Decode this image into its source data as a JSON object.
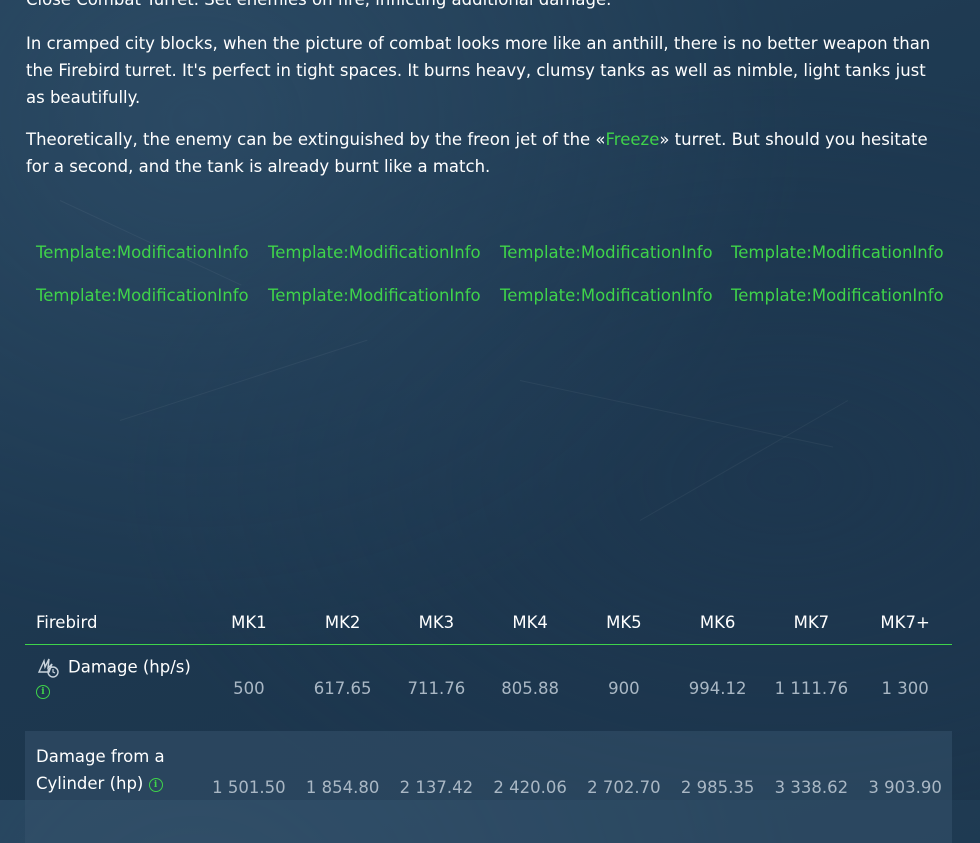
{
  "intro_line": "Close Combat Turret. Set enemies on fire, inflicting additional damage.",
  "paragraph1": "In cramped city blocks, when the picture of combat looks more like an anthill, there is no better weapon than the Firebird turret. It's perfect in tight spaces. It burns heavy, clumsy tanks as well as nimble, light tanks just as beautifully.",
  "paragraph2": {
    "before": "Theoretically, the enemy can be extinguished by the freon jet of the «",
    "link": "Freeze",
    "after": "» turret. But should you hesitate for a second, and the tank is already burnt like a match."
  },
  "modification_links": [
    "Template:ModificationInfo",
    "Template:ModificationInfo",
    "Template:ModificationInfo",
    "Template:ModificationInfo",
    "Template:ModificationInfo",
    "Template:ModificationInfo",
    "Template:ModificationInfo",
    "Template:ModificationInfo"
  ],
  "table": {
    "header": [
      "Firebird",
      "MK1",
      "MK2",
      "MK3",
      "MK4",
      "MK5",
      "MK6",
      "MK7",
      "MK7+"
    ],
    "rows": [
      {
        "label": "Damage (hp/s)",
        "icon": "flame-damage-icon",
        "values": [
          "500",
          "617.65",
          "711.76",
          "805.88",
          "900",
          "994.12",
          "1 111.76",
          "1 300"
        ]
      },
      {
        "label": "Damage from a Cylinder (hp)",
        "icon": "info-icon",
        "values": [
          "1 501.50",
          "1 854.80",
          "2 137.42",
          "2 420.06",
          "2 702.70",
          "2 985.35",
          "3 338.62",
          "3 903.90"
        ]
      }
    ]
  },
  "colors": {
    "link": "#3fd34a",
    "background": "#1f3a52",
    "value_text": "#a9b7c4"
  }
}
